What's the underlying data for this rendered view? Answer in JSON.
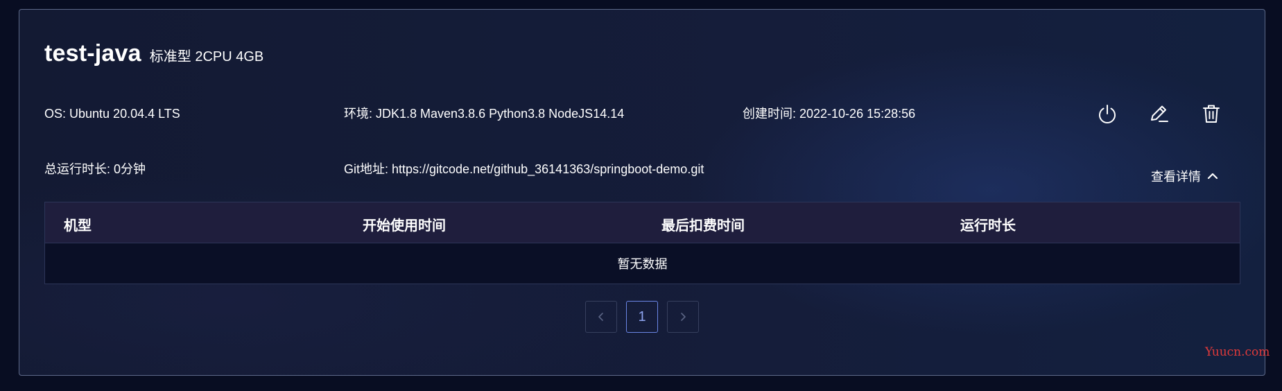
{
  "card": {
    "title": "test-java",
    "spec": "标准型 2CPU 4GB"
  },
  "info": {
    "os": "OS: Ubuntu 20.04.4 LTS",
    "env": "环境: JDK1.8 Maven3.8.6 Python3.8 NodeJS14.14",
    "created": "创建时间: 2022-10-26 15:28:56",
    "runtime": "总运行时长: 0分钟",
    "git": "Git地址: https://gitcode.net/github_36141363/springboot-demo.git"
  },
  "actions": {
    "power_icon": "power-icon",
    "edit_icon": "edit-icon",
    "delete_icon": "trash-icon",
    "details_label": "查看详情",
    "details_icon": "chevron-up-icon"
  },
  "table": {
    "columns": [
      "机型",
      "开始使用时间",
      "最后扣费时间",
      "运行时长"
    ],
    "empty_text": "暂无数据"
  },
  "pagination": {
    "current_page": "1",
    "prev_icon": "chevron-left-icon",
    "next_icon": "chevron-right-icon"
  },
  "watermark": "Yuucn.com",
  "colors": {
    "page_bg": "#080d22",
    "header_bg": "#1f1e3d",
    "active_page": "#8ea4f0"
  }
}
